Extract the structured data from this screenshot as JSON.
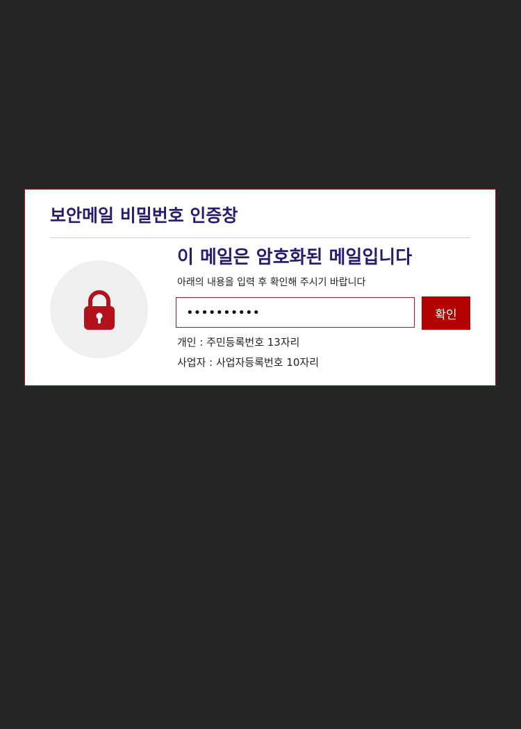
{
  "dialog": {
    "title": "보안메일 비밀번호 인증창",
    "headline": "이 메일은 암호화된 메일입니다",
    "instruction": "아래의 내용을 입력 후 확인해 주시기 바랍니다",
    "password_value": "••••••••••",
    "confirm_label": "확인",
    "hint_personal": "개인 : 주민등록번호 13자리",
    "hint_business": "사업자 : 사업자등록번호 10자리",
    "lock_icon": "lock-icon"
  },
  "colors": {
    "background": "#262626",
    "accent": "#b30000",
    "title": "#2a1a6e",
    "lock": "#b3121c"
  }
}
